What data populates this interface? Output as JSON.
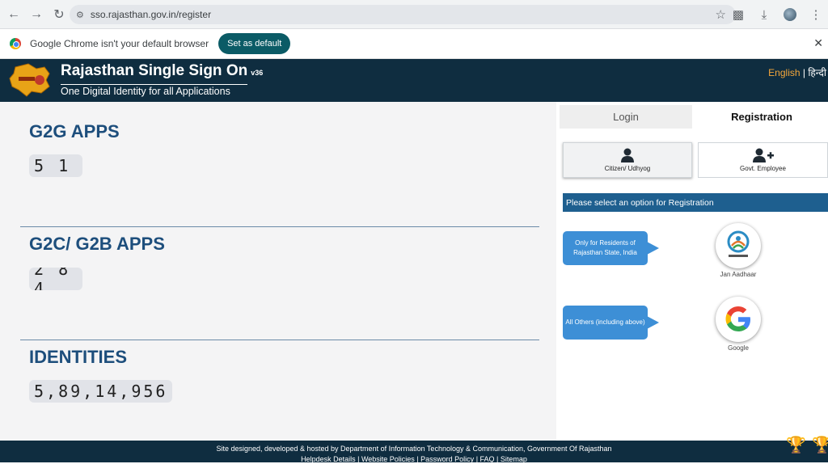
{
  "browser": {
    "url": "sso.rajasthan.gov.in/register",
    "infobar_text": "Google Chrome isn't your default browser",
    "set_default_label": "Set as default"
  },
  "header": {
    "title": "Rajasthan Single Sign On",
    "version": "v36",
    "subtitle": "One Digital Identity for all Applications",
    "lang_en": "English",
    "lang_sep": " | ",
    "lang_hi": "हिन्दी"
  },
  "stats": {
    "g2g_title": "G2G APPS",
    "g2g_value": "5 1",
    "g2c_title": "G2C/ G2B APPS",
    "g2c_value": "2 8 4",
    "identities_title": "IDENTITIES",
    "identities_value": "5,89,14,956"
  },
  "tabs": {
    "login": "Login",
    "registration": "Registration"
  },
  "options": {
    "citizen": "Citizen/ Udhyog",
    "govt": "Govt. Employee"
  },
  "select_prompt": "Please select an option for Registration",
  "register_options": {
    "residents_bubble": "Only for Residents of Rajasthan State, India",
    "jan_aadhaar_label": "Jan Aadhaar",
    "others_bubble": "All Others (including above)",
    "google_label": "Google"
  },
  "footer": {
    "line1": "Site designed, developed & hosted by Department of Information Technology & Communication, Government Of Rajasthan",
    "links": [
      "Helpdesk Details",
      "Website Policies",
      "Password Policy",
      "FAQ",
      "Sitemap"
    ]
  },
  "colors": {
    "header_bg": "#0f2d40",
    "accent_blue": "#1e5f8f",
    "bubble_blue": "#3d8fd6",
    "title_blue": "#1d4e7c",
    "lang_accent": "#f4a73b"
  }
}
